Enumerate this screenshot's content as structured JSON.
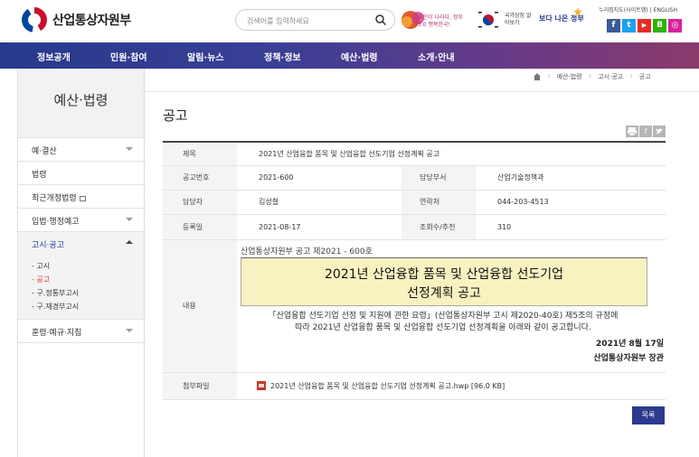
{
  "header": {
    "logo_text": "산업통상자원부",
    "search_placeholder": "검색어를 입력하세요",
    "banner1_text": "국민이 나라다, 정부3.0 행복한국!",
    "banner2_text": "국가상징 알아보기",
    "banner3_text": "보다 나은 정부",
    "util_links": [
      "누리집지도(사이트맵)",
      "ENGLISH"
    ],
    "sns": [
      {
        "name": "facebook",
        "glyph": "f",
        "color": "#3b5998"
      },
      {
        "name": "twitter",
        "glyph": "t",
        "color": "#1da1f2"
      },
      {
        "name": "youtube",
        "glyph": "▶",
        "color": "#e52d27"
      },
      {
        "name": "blog",
        "glyph": "B",
        "color": "#2db400"
      },
      {
        "name": "instagram",
        "glyph": "◎",
        "color": "#d6249f"
      }
    ]
  },
  "gnb": [
    "정보공개",
    "민원·참여",
    "알림·뉴스",
    "정책·정보",
    "예산·법령",
    "소개·안내"
  ],
  "sidebar": {
    "title": "예산·법령",
    "items": [
      {
        "label": "예·결산",
        "arrow": true
      },
      {
        "label": "법령",
        "arrow": false
      },
      {
        "label": "최근개정법령",
        "arrow": false,
        "external": true
      },
      {
        "label": "입법·행정예고",
        "arrow": true
      },
      {
        "label": "고시·공고",
        "arrow": true,
        "active": true
      }
    ],
    "sub_items": [
      "- 고시",
      "- 공고",
      "- 구.정통부고시",
      "- 구.재경부고시"
    ],
    "last_item": "훈령·예규·지침"
  },
  "breadcrumb": {
    "home_icon": "home-icon",
    "items": [
      "예산·법령",
      "고시·공고",
      "공고"
    ]
  },
  "page_title": "공고",
  "tools": [
    "print-icon",
    "facebook-icon",
    "twitter-icon"
  ],
  "board": {
    "subject_label": "제목",
    "subject": "2021년 산업융합 품목 및 산업융합 선도기업 선정계획 공고",
    "no_label": "공고번호",
    "no": "2021-600",
    "dept_label": "담당부서",
    "dept": "산업기술정책과",
    "manager_label": "담당자",
    "manager": "김성철",
    "contact_label": "연락처",
    "contact": "044-203-4513",
    "date_label": "등록일",
    "date": "2021-08-17",
    "views_label": "조회수/추천",
    "views": "310",
    "content_label": "내용",
    "attach_label": "첨부파일",
    "attachment": "2021년 산업융합 품목 및 산업융합 선도기업 선정계획 공고.hwp [96.0 KB]"
  },
  "notice": {
    "doc_no": "산업통상자원부 공고 제2021 - 600호",
    "title_line1": "2021년 산업융합 품목 및 산업융합 선도기업",
    "title_line2": "선정계획 공고",
    "body_line1": "「산업융합 선도기업 선정 및 지원에 관한 요령」(산업통상자원부 고시 제2020-40호) 제5조의 규정에",
    "body_line2": "따라 2021년 산업융합 품목 및 산업융합 선도기업 선정계획을 아래와 같이 공고합니다.",
    "date": "2021년 8월 17일",
    "org": "산업통상자원부 장관"
  },
  "list_button": "목록"
}
